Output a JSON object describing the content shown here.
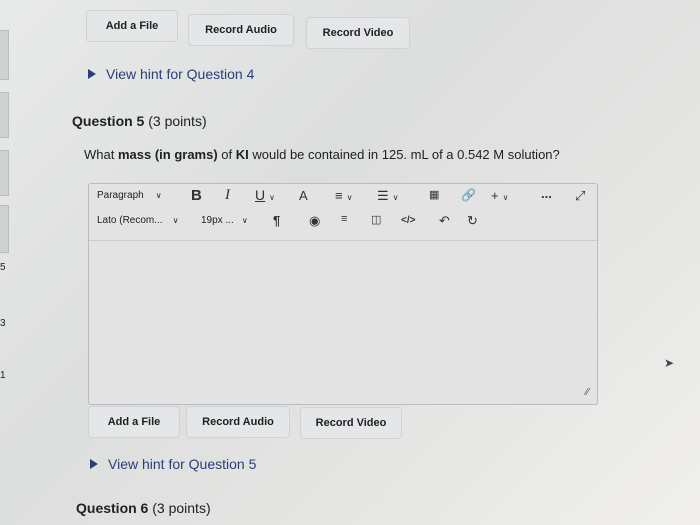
{
  "top_buttons": {
    "add_file": "Add a File",
    "record_audio": "Record Audio",
    "record_video": "Record Video"
  },
  "hint4": "View hint for Question 4",
  "question5": {
    "number": "Question 5",
    "points": "(3 points)",
    "text_pre": "What ",
    "text_b1": "mass (in grams)",
    "text_mid": " of ",
    "text_b2": "KI",
    "text_post": " would be contained in 125. mL of a 0.542 M solution?"
  },
  "editor": {
    "paragraph": "Paragraph",
    "font": "Lato (Recom...",
    "size": "19px ...",
    "bold": "B",
    "italic": "I",
    "underline": "U",
    "more": "...",
    "plus": "+"
  },
  "bottom_buttons": {
    "add_file": "Add a File",
    "record_audio": "Record Audio",
    "record_video": "Record Video"
  },
  "hint5": "View hint for Question 5",
  "question6": {
    "number": "Question 6",
    "points": "(3 points)"
  },
  "left_edge_marks": [
    "5",
    "3",
    "1"
  ]
}
